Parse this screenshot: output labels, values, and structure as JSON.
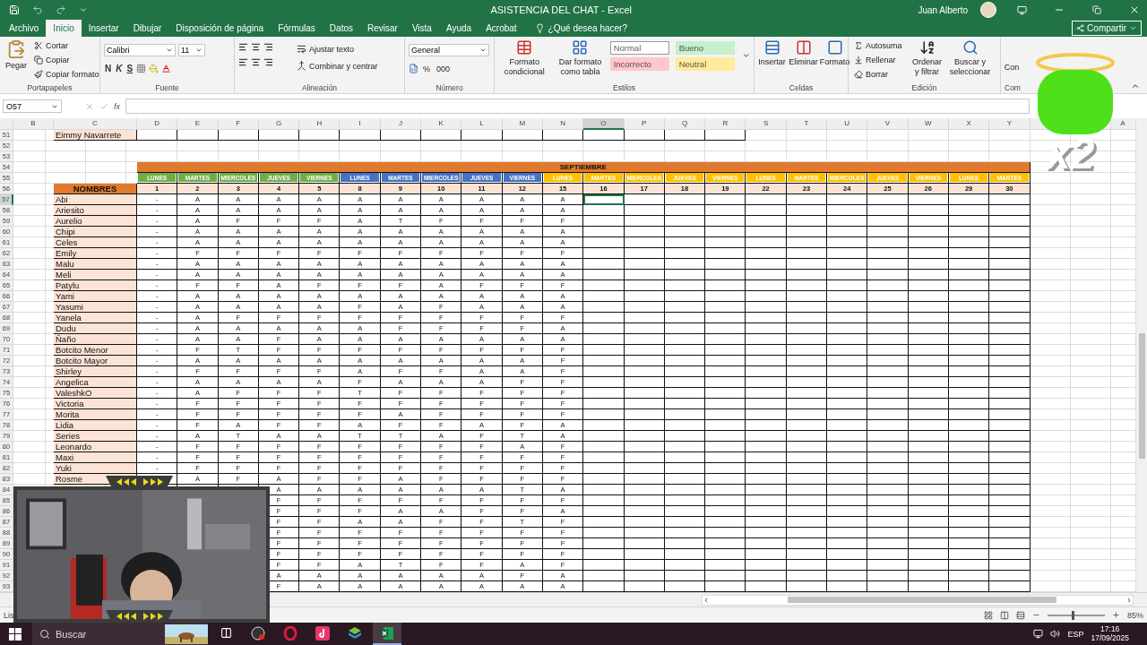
{
  "title_bar": {
    "title": "ASISTENCIA DEL CHAT  -  Excel",
    "user": "Juan Alberto"
  },
  "ribbon_tabs": [
    {
      "label": "Archivo",
      "selected": false
    },
    {
      "label": "Inicio",
      "selected": true
    },
    {
      "label": "Insertar",
      "selected": false
    },
    {
      "label": "Dibujar",
      "selected": false
    },
    {
      "label": "Disposición de página",
      "selected": false
    },
    {
      "label": "Fórmulas",
      "selected": false
    },
    {
      "label": "Datos",
      "selected": false
    },
    {
      "label": "Revisar",
      "selected": false
    },
    {
      "label": "Vista",
      "selected": false
    },
    {
      "label": "Ayuda",
      "selected": false
    },
    {
      "label": "Acrobat",
      "selected": false
    }
  ],
  "tell_me": "¿Qué desea hacer?",
  "share_button": "Compartir",
  "ribbon": {
    "clipboard": {
      "label": "Portapapeles",
      "paste": "Pegar",
      "items": [
        "Cortar",
        "Copiar",
        "Copiar formato"
      ]
    },
    "font": {
      "label": "Fuente",
      "name": "Calibri",
      "size": "11",
      "styles": [
        "N",
        "K",
        "S"
      ]
    },
    "alignment": {
      "label": "Alineación",
      "items": [
        "Ajustar texto",
        "Combinar y centrar"
      ]
    },
    "number": {
      "label": "Número",
      "format": "General",
      "symbols": [
        "%",
        "000"
      ]
    },
    "styles": {
      "label": "Estilos",
      "buttons": [
        "Formato condicional",
        "Dar formato como tabla"
      ],
      "cells": [
        {
          "label": "Normal",
          "color": "#ffffff"
        },
        {
          "label": "Bueno",
          "color": "#c6efce"
        },
        {
          "label": "Incorrecto",
          "color": "#ffc7ce"
        },
        {
          "label": "Neutral",
          "color": "#ffeb9c"
        }
      ]
    },
    "cells": {
      "label": "Celdas",
      "buttons": [
        "Insertar",
        "Eliminar",
        "Formato"
      ]
    },
    "editing": {
      "label": "Edición",
      "items": [
        "Autosuma",
        "Rellenar",
        "Borrar"
      ],
      "buttons": [
        "Ordenar y filtrar",
        "Buscar y seleccionar"
      ]
    },
    "addins": {
      "label": "Com",
      "button": "Con"
    }
  },
  "formula_bar": {
    "name_box": "O57",
    "function_label": "fx"
  },
  "columns": [
    {
      "label": "B",
      "selected": false
    },
    {
      "label": "C",
      "selected": false
    },
    {
      "label": "D",
      "selected": false
    },
    {
      "label": "E",
      "selected": false
    },
    {
      "label": "F",
      "selected": false
    },
    {
      "label": "G",
      "selected": false
    },
    {
      "label": "H",
      "selected": false
    },
    {
      "label": "I",
      "selected": false
    },
    {
      "label": "J",
      "selected": false
    },
    {
      "label": "K",
      "selected": false
    },
    {
      "label": "L",
      "selected": false
    },
    {
      "label": "M",
      "selected": false
    },
    {
      "label": "N",
      "selected": false
    },
    {
      "label": "O",
      "selected": true
    },
    {
      "label": "P",
      "selected": false
    },
    {
      "label": "Q",
      "selected": false
    },
    {
      "label": "R",
      "selected": false
    },
    {
      "label": "S",
      "selected": false
    },
    {
      "label": "T",
      "selected": false
    },
    {
      "label": "U",
      "selected": false
    },
    {
      "label": "V",
      "selected": false
    },
    {
      "label": "W",
      "selected": false
    },
    {
      "label": "X",
      "selected": false
    },
    {
      "label": "Y",
      "selected": false
    }
  ],
  "cut_column": "A",
  "rows": [
    {
      "number": "51",
      "selected": false,
      "kind": "entry",
      "name": "Eimmy Navarrete"
    },
    {
      "number": "52",
      "selected": false,
      "kind": "blank"
    },
    {
      "number": "53",
      "selected": false,
      "kind": "blank"
    },
    {
      "number": "54",
      "selected": false,
      "kind": "month",
      "label": "SEPTIEMBRE"
    },
    {
      "number": "55",
      "selected": false,
      "kind": "weekdays",
      "days": [
        {
          "label": "LUNES",
          "color": "#70ad47"
        },
        {
          "label": "MARTES",
          "color": "#70ad47"
        },
        {
          "label": "MIERCOLES",
          "color": "#70ad47"
        },
        {
          "label": "JUEVES",
          "color": "#70ad47"
        },
        {
          "label": "VIERNES",
          "color": "#70ad47"
        },
        {
          "label": "LUNES",
          "color": "#4472c4"
        },
        {
          "label": "MARTES",
          "color": "#4472c4"
        },
        {
          "label": "MIERCOLES",
          "color": "#4472c4"
        },
        {
          "label": "JUEVES",
          "color": "#4472c4"
        },
        {
          "label": "VIERNES",
          "color": "#4472c4"
        },
        {
          "label": "LUNES",
          "color": "#ffc000"
        },
        {
          "label": "MARTES",
          "color": "#ffc000"
        },
        {
          "label": "MIERCOLES",
          "color": "#ffc000"
        },
        {
          "label": "JUEVES",
          "color": "#ffc000"
        },
        {
          "label": "VIERNES",
          "color": "#ffc000"
        },
        {
          "label": "LUNES",
          "color": "#ffc000"
        },
        {
          "label": "MARTES",
          "color": "#ffc000"
        },
        {
          "label": "MIERCOLES",
          "color": "#ffc000"
        },
        {
          "label": "JUEVES",
          "color": "#ffc000"
        },
        {
          "label": "VIERNES",
          "color": "#ffc000"
        },
        {
          "label": "LUNES",
          "color": "#ffc000"
        },
        {
          "label": "MARTES",
          "color": "#ffc000"
        }
      ]
    },
    {
      "number": "56",
      "selected": false,
      "kind": "dates",
      "name": "NOMBRES",
      "dates": [
        "1",
        "2",
        "3",
        "4",
        "5",
        "8",
        "9",
        "10",
        "11",
        "12",
        "15",
        "16",
        "17",
        "18",
        "19",
        "22",
        "23",
        "24",
        "25",
        "26",
        "29",
        "30"
      ]
    },
    {
      "number": "57",
      "selected": true,
      "kind": "student",
      "name": "Abi",
      "marks": [
        "-",
        "A",
        "A",
        "A",
        "A",
        "A",
        "A",
        "A",
        "A",
        "A",
        "A"
      ]
    },
    {
      "number": "58",
      "selected": false,
      "kind": "student",
      "name": "Ariesito",
      "marks": [
        "-",
        "A",
        "A",
        "A",
        "A",
        "A",
        "A",
        "A",
        "A",
        "A",
        "A"
      ]
    },
    {
      "number": "59",
      "selected": false,
      "kind": "student",
      "name": "Aurelio",
      "marks": [
        "-",
        "A",
        "F",
        "F",
        "F",
        "A",
        "T",
        "F",
        "F",
        "F",
        "F"
      ]
    },
    {
      "number": "60",
      "selected": false,
      "kind": "student",
      "name": "Chipi",
      "marks": [
        "-",
        "A",
        "A",
        "A",
        "A",
        "A",
        "A",
        "A",
        "A",
        "A",
        "A"
      ]
    },
    {
      "number": "61",
      "selected": false,
      "kind": "student",
      "name": "Celes",
      "marks": [
        "-",
        "A",
        "A",
        "A",
        "A",
        "A",
        "A",
        "A",
        "A",
        "A",
        "A"
      ]
    },
    {
      "number": "62",
      "selected": false,
      "kind": "student",
      "name": "Emily",
      "marks": [
        "-",
        "F",
        "F",
        "F",
        "F",
        "F",
        "F",
        "F",
        "F",
        "F",
        "F"
      ]
    },
    {
      "number": "63",
      "selected": false,
      "kind": "student",
      "name": "Malu",
      "marks": [
        "-",
        "A",
        "A",
        "A",
        "A",
        "A",
        "A",
        "A",
        "A",
        "A",
        "A"
      ]
    },
    {
      "number": "64",
      "selected": false,
      "kind": "student",
      "name": "Meli",
      "marks": [
        "-",
        "A",
        "A",
        "A",
        "A",
        "A",
        "A",
        "A",
        "A",
        "A",
        "A"
      ]
    },
    {
      "number": "65",
      "selected": false,
      "kind": "student",
      "name": "Patylu",
      "marks": [
        "-",
        "F",
        "F",
        "A",
        "F",
        "F",
        "F",
        "A",
        "F",
        "F",
        "F"
      ]
    },
    {
      "number": "66",
      "selected": false,
      "kind": "student",
      "name": "Yami",
      "marks": [
        "-",
        "A",
        "A",
        "A",
        "A",
        "A",
        "A",
        "A",
        "A",
        "A",
        "A"
      ]
    },
    {
      "number": "67",
      "selected": false,
      "kind": "student",
      "name": "Yasumi",
      "marks": [
        "-",
        "A",
        "A",
        "A",
        "A",
        "F",
        "A",
        "F",
        "A",
        "A",
        "A"
      ]
    },
    {
      "number": "68",
      "selected": false,
      "kind": "student",
      "name": "Yanela",
      "marks": [
        "-",
        "A",
        "F",
        "F",
        "F",
        "F",
        "F",
        "F",
        "F",
        "F",
        "F"
      ]
    },
    {
      "number": "69",
      "selected": false,
      "kind": "student",
      "name": "Dudu",
      "marks": [
        "-",
        "A",
        "A",
        "A",
        "A",
        "A",
        "F",
        "F",
        "F",
        "F",
        "A"
      ]
    },
    {
      "number": "70",
      "selected": false,
      "kind": "student",
      "name": "Ñaño",
      "marks": [
        "-",
        "A",
        "A",
        "F",
        "A",
        "A",
        "A",
        "A",
        "A",
        "A",
        "A"
      ]
    },
    {
      "number": "71",
      "selected": false,
      "kind": "student",
      "name": "Botcito Menor",
      "marks": [
        "-",
        "F",
        "T",
        "F",
        "F",
        "F",
        "F",
        "F",
        "F",
        "F",
        "F"
      ]
    },
    {
      "number": "72",
      "selected": false,
      "kind": "student",
      "name": "Botcito Mayor",
      "marks": [
        "-",
        "A",
        "A",
        "A",
        "A",
        "A",
        "A",
        "A",
        "A",
        "A",
        "F"
      ]
    },
    {
      "number": "73",
      "selected": false,
      "kind": "student",
      "name": "Shirley",
      "marks": [
        "-",
        "F",
        "F",
        "F",
        "F",
        "A",
        "F",
        "F",
        "A",
        "A",
        "F"
      ]
    },
    {
      "number": "74",
      "selected": false,
      "kind": "student",
      "name": "Angelica",
      "marks": [
        "-",
        "A",
        "A",
        "A",
        "A",
        "F",
        "A",
        "A",
        "A",
        "F",
        "F"
      ]
    },
    {
      "number": "75",
      "selected": false,
      "kind": "student",
      "name": "ValeshkO",
      "marks": [
        "-",
        "A",
        "F",
        "F",
        "F",
        "T",
        "F",
        "F",
        "F",
        "F",
        "F"
      ]
    },
    {
      "number": "76",
      "selected": false,
      "kind": "student",
      "name": "Victoria",
      "marks": [
        "-",
        "F",
        "F",
        "F",
        "F",
        "F",
        "F",
        "F",
        "F",
        "F",
        "F"
      ]
    },
    {
      "number": "77",
      "selected": false,
      "kind": "student",
      "name": "Morita",
      "marks": [
        "-",
        "F",
        "F",
        "F",
        "F",
        "F",
        "A",
        "F",
        "F",
        "F",
        "F"
      ]
    },
    {
      "number": "78",
      "selected": false,
      "kind": "student",
      "name": "Lidia",
      "marks": [
        "-",
        "F",
        "A",
        "F",
        "F",
        "A",
        "F",
        "F",
        "A",
        "F",
        "A"
      ]
    },
    {
      "number": "79",
      "selected": false,
      "kind": "student",
      "name": "Series",
      "marks": [
        "-",
        "A",
        "T",
        "A",
        "A",
        "T",
        "T",
        "A",
        "F",
        "T",
        "A"
      ]
    },
    {
      "number": "80",
      "selected": false,
      "kind": "student",
      "name": "Leonardo",
      "marks": [
        "-",
        "F",
        "F",
        "F",
        "F",
        "F",
        "F",
        "F",
        "F",
        "A",
        "F"
      ]
    },
    {
      "number": "81",
      "selected": false,
      "kind": "student",
      "name": "Maxi",
      "marks": [
        "-",
        "F",
        "F",
        "F",
        "F",
        "F",
        "F",
        "F",
        "F",
        "F",
        "F"
      ]
    },
    {
      "number": "82",
      "selected": false,
      "kind": "student",
      "name": "Yuki",
      "marks": [
        "-",
        "F",
        "F",
        "F",
        "F",
        "F",
        "F",
        "F",
        "F",
        "F",
        "F"
      ]
    },
    {
      "number": "83",
      "selected": false,
      "kind": "student",
      "name": "Rosme",
      "marks": [
        "A",
        "F",
        "A",
        "F",
        "F",
        "A",
        "F",
        "F",
        "F",
        "F"
      ]
    },
    {
      "number": "84",
      "selected": false,
      "kind": "student",
      "marks": [
        "A",
        "A",
        "A",
        "A",
        "A",
        "A",
        "T",
        "A"
      ]
    },
    {
      "number": "85",
      "selected": false,
      "kind": "student",
      "marks": [
        "F",
        "F",
        "F",
        "F",
        "F",
        "F",
        "F",
        "F"
      ]
    },
    {
      "number": "86",
      "selected": false,
      "kind": "student",
      "marks": [
        "F",
        "F",
        "F",
        "A",
        "A",
        "F",
        "F",
        "A"
      ]
    },
    {
      "number": "87",
      "selected": false,
      "kind": "student",
      "marks": [
        "F",
        "F",
        "A",
        "A",
        "F",
        "F",
        "T",
        "F"
      ]
    },
    {
      "number": "88",
      "selected": false,
      "kind": "student",
      "marks": [
        "F",
        "F",
        "F",
        "F",
        "F",
        "F",
        "F",
        "F"
      ]
    },
    {
      "number": "89",
      "selected": false,
      "kind": "student",
      "marks": [
        "F",
        "F",
        "F",
        "F",
        "F",
        "F",
        "F",
        "F"
      ]
    },
    {
      "number": "90",
      "selected": false,
      "kind": "student",
      "marks": [
        "F",
        "F",
        "F",
        "F",
        "F",
        "F",
        "F",
        "F"
      ]
    },
    {
      "number": "91",
      "selected": false,
      "kind": "student",
      "marks": [
        "F",
        "F",
        "A",
        "T",
        "F",
        "F",
        "A",
        "F"
      ]
    },
    {
      "number": "92",
      "selected": false,
      "kind": "student",
      "marks": [
        "A",
        "A",
        "A",
        "A",
        "A",
        "A",
        "F",
        "A"
      ]
    },
    {
      "number": "93",
      "selected": false,
      "kind": "student",
      "marks": [
        "F",
        "A",
        "A",
        "A",
        "A",
        "A",
        "A",
        "A"
      ]
    }
  ],
  "status_bar": {
    "status": "Lis",
    "zoom": "85%",
    "zoom_slider": {
      "level": 0.42
    }
  },
  "taskbar": {
    "search": "Buscar",
    "language": "ESP",
    "time": "17:16",
    "date": "17/09/2025"
  },
  "overlay": {
    "sticker_text": "x2"
  }
}
